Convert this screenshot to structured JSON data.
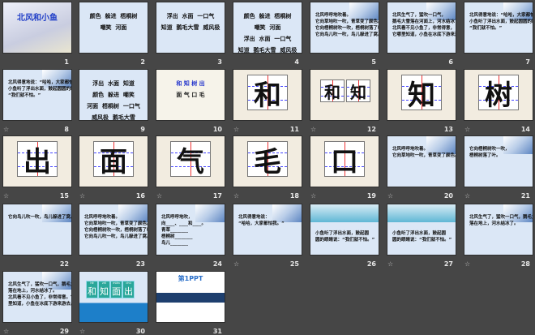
{
  "slides": [
    {
      "n": "1",
      "kind": "title",
      "text": [
        "北风和小鱼"
      ],
      "anim": false
    },
    {
      "n": "2",
      "kind": "words",
      "text": [
        "颜色  躲进  梧桐树",
        "嘲笑  河面"
      ],
      "anim": false
    },
    {
      "n": "3",
      "kind": "words",
      "text": [
        "浮出  水面  一口气",
        "知道  鹅毛大雪  威风极"
      ],
      "anim": false
    },
    {
      "n": "4",
      "kind": "words",
      "text": [
        "颜色  躲进  梧桐树",
        "嘲笑  河面",
        "浮出  水面  一口气",
        "知道  鹅毛大雪  威风极"
      ],
      "anim": false
    },
    {
      "n": "5",
      "kind": "lines",
      "text": [
        "北风呼呼地吹着。",
        "它向草地吹一吹，青草变了颜色。",
        "它向梧桐树吹一吹，梧桐树落了叶。",
        "它向鸟儿吹一吹，鸟儿躲进了窝。"
      ],
      "anim": false
    },
    {
      "n": "6",
      "kind": "lines",
      "text": [
        "北风生气了，猛吹一口气，",
        "鹅毛大雪落在河面上，河水结冰了。",
        "北风看不见小鱼了，非常得意，",
        "它哪里知道，小鱼在冰底下游来游去。"
      ],
      "anim": false
    },
    {
      "n": "7",
      "kind": "lines",
      "text": [
        "北风得意地说：“哈哈，大家都怕我。”",
        "小鱼听了浮出水面，鼓起圆圆的眼睛说：",
        "“我们就不怕。”"
      ],
      "anim": false
    },
    {
      "n": "8",
      "kind": "lines",
      "text": [
        "北风得意地说：“哈哈，大家都怕我。”",
        "小鱼听了浮出水面，鼓起圆圆的眼睛说：",
        "“我们就不怕。”"
      ],
      "anim": true
    },
    {
      "n": "9",
      "kind": "words",
      "text": [
        "浮出  水面  知道",
        "颜色  躲进  嘲笑",
        "河面  梧桐树  一口气",
        "威风极  鹅毛大雪"
      ],
      "anim": false
    },
    {
      "n": "10",
      "kind": "words",
      "text": [
        "和 知 树 出",
        "面 气 口 毛"
      ],
      "anim": false
    },
    {
      "n": "11",
      "kind": "char",
      "text": [
        "和"
      ],
      "anim": true
    },
    {
      "n": "12",
      "kind": "char2",
      "text": [
        "和",
        "知"
      ],
      "anim": true
    },
    {
      "n": "13",
      "kind": "char",
      "text": [
        "知"
      ],
      "anim": false
    },
    {
      "n": "14",
      "kind": "char",
      "text": [
        "树"
      ],
      "anim": true
    },
    {
      "n": "15",
      "kind": "char",
      "text": [
        "出"
      ],
      "anim": true
    },
    {
      "n": "16",
      "kind": "char",
      "text": [
        "面"
      ],
      "anim": true
    },
    {
      "n": "17",
      "kind": "char",
      "text": [
        "气"
      ],
      "anim": true
    },
    {
      "n": "18",
      "kind": "char",
      "text": [
        "毛"
      ],
      "anim": true
    },
    {
      "n": "19",
      "kind": "char",
      "text": [
        "口"
      ],
      "anim": true
    },
    {
      "n": "20",
      "kind": "lines",
      "text": [
        "北风呼呼地吹着。",
        "它向草地吹一吹，青草变了颜色。"
      ],
      "anim": true
    },
    {
      "n": "21",
      "kind": "lines",
      "text": [
        "它向梧桐树吹一吹，",
        "梧桐树落了叶。"
      ],
      "anim": true
    },
    {
      "n": "22",
      "kind": "lines",
      "text": [
        "它向鸟儿吹一吹，鸟儿躲进了窝。"
      ],
      "anim": false
    },
    {
      "n": "23",
      "kind": "lines",
      "text": [
        "北风呼呼地吹着。",
        "它向草地吹一吹，青草变了颜色。",
        "它向梧桐树吹一吹，梧桐树落了叶。",
        "它向鸟儿吹一吹，鸟儿躲进了窝。"
      ],
      "anim": false
    },
    {
      "n": "24",
      "kind": "lines",
      "text": [
        "北风呼呼地吹，",
        "向____、____和____。",
        "青草________",
        "梧桐树________",
        "鸟儿________"
      ],
      "anim": false
    },
    {
      "n": "25",
      "kind": "lines",
      "text": [
        "北风得意地说：",
        "“哈哈，大家都怕我。”"
      ],
      "anim": true
    },
    {
      "n": "26",
      "kind": "fish",
      "text": [
        "小鱼听了浮出水面，鼓起圆",
        "圆的眼睛说：“我们就不怕。”"
      ],
      "anim": false
    },
    {
      "n": "27",
      "kind": "fish",
      "text": [
        "小鱼听了浮出水面，鼓起圆",
        "圆的眼睛说：“我们就不怕。”"
      ],
      "anim": true
    },
    {
      "n": "28",
      "kind": "lines",
      "text": [
        "北风生气了，猛吹一口气，鹅毛大雪",
        "落在地上，河水结冰了。"
      ],
      "anim": true
    },
    {
      "n": "29",
      "kind": "lines",
      "text": [
        "北风生气了，猛吹一口气，鹅毛大雪",
        "落在地上，河水结冰了。",
        "北风看不见小鱼了，非常得意。它哪",
        "里知道，小鱼在冰底下游来游去。"
      ],
      "anim": true
    },
    {
      "n": "30",
      "kind": "pinyin",
      "text": [
        "和",
        "知",
        "面",
        "出"
      ],
      "pinyin": [
        "hé",
        "zhī",
        "miàn",
        "chū"
      ],
      "anim": true
    },
    {
      "n": "31",
      "kind": "brand",
      "text": [
        "第1PPT"
      ],
      "anim": false
    }
  ],
  "anim_icon": "☆"
}
